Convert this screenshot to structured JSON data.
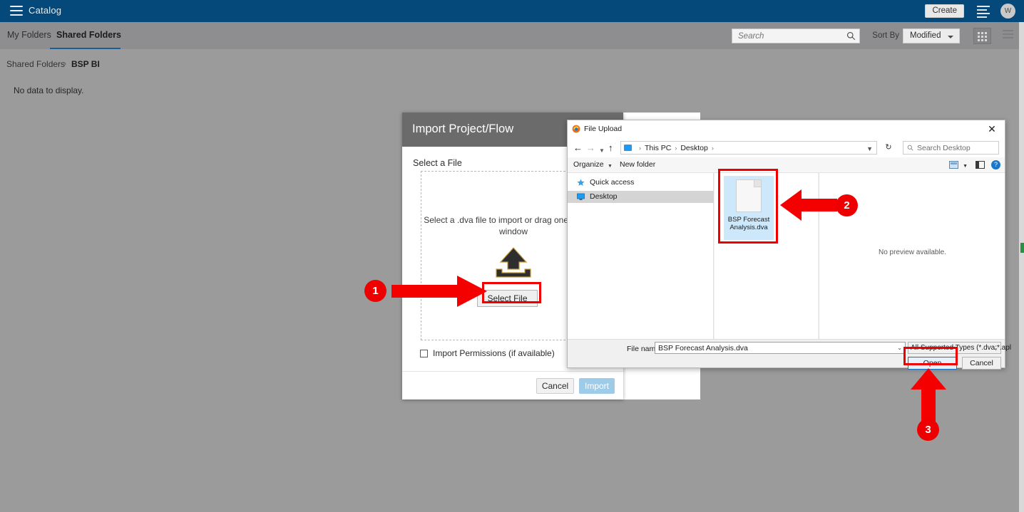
{
  "app": {
    "title": "Catalog",
    "hamburger_icon": "hamburger-menu-icon",
    "create_label": "Create",
    "menu_icon": "list-menu-icon",
    "avatar_initial": "W"
  },
  "subnav": {
    "tabs": [
      {
        "label": "My Folders",
        "active": false
      },
      {
        "label": "Shared Folders",
        "active": true
      }
    ],
    "search_placeholder": "Search",
    "search_value": "",
    "search_icon": "search-icon",
    "sort_by_label": "Sort By",
    "sort_value": "Modified",
    "sort_options": [
      "Modified"
    ],
    "grid_view_icon": "grid-view-icon",
    "list_view_icon": "list-view-icon"
  },
  "breadcrumb": {
    "root": "Shared Folders",
    "separator": "›",
    "current": "BSP BI"
  },
  "content": {
    "empty_message": "No data to display."
  },
  "import_dialog": {
    "title": "Import Project/Flow",
    "section_label": "Select a File",
    "dropzone_text": "Select a .dva file to import or drag one onto this window",
    "upload_icon": "upload-arrow-icon",
    "select_file_label": "Select File",
    "permissions_label": "Import Permissions (if available)",
    "permissions_checked": false,
    "cancel_label": "Cancel",
    "import_label": "Import"
  },
  "file_upload": {
    "window_title": "File Upload",
    "app_icon": "firefox-icon",
    "close_icon": "close-icon",
    "nav": {
      "back_icon": "arrow-left-icon",
      "forward_icon": "arrow-right-icon",
      "recent_icon": "chevron-down-icon",
      "up_icon": "arrow-up-icon",
      "pc_icon": "this-pc-icon",
      "crumb_1": "This PC",
      "crumb_2": "Desktop",
      "address_caret": "⌄",
      "refresh_icon": "refresh-icon",
      "search_placeholder": "Search Desktop",
      "search_icon": "search-icon"
    },
    "toolbar": {
      "organize_label": "Organize",
      "organize_caret": "▼",
      "new_folder_label": "New folder",
      "layout_icon": "view-layout-icon",
      "layout_caret": "▼",
      "preview_pane_icon": "preview-pane-icon",
      "help_icon": "help-icon",
      "help_glyph": "?"
    },
    "sidebar": [
      {
        "label": "Quick access",
        "icon": "pin-star-icon",
        "selected": false
      },
      {
        "label": "Desktop",
        "icon": "desktop-monitor-icon",
        "selected": true
      }
    ],
    "files": [
      {
        "name": "BSP Forecast Analysis.dva",
        "icon": "generic-file-icon",
        "selected": true
      }
    ],
    "preview_message": "No preview available.",
    "file_name_label": "File name:",
    "file_name_value": "BSP Forecast Analysis.dva",
    "file_name_caret": "⌄",
    "file_type_value": "All Supported Types (*.dva;*.apl",
    "file_type_caret": "⌄",
    "open_label": "Open",
    "cancel_label": "Cancel"
  },
  "annotations": [
    {
      "number": "1",
      "arrow": "arrow-right",
      "target": "select-file-button"
    },
    {
      "number": "2",
      "arrow": "arrow-left",
      "target": "file-tile"
    },
    {
      "number": "3",
      "arrow": "arrow-up",
      "target": "open-button"
    }
  ],
  "colors": {
    "header_blue": "#04497a",
    "subnav_gray": "#8e8e90",
    "page_gray": "#9b9b9b",
    "dialog_titlebar": "#6b6b6b",
    "annotation_red": "#ee0000",
    "import_button_blue": "#9ecbe8",
    "tab_underline": "#1a5f8f",
    "scroll_thumb_green": "#2a8f3f"
  }
}
